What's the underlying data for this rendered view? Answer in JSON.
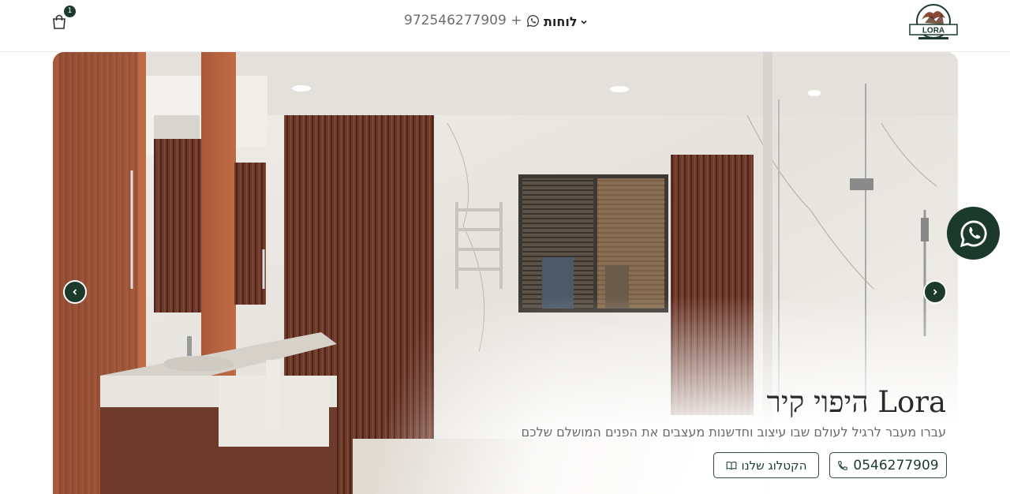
{
  "header": {
    "cart_count": "1",
    "phone": "972546277909 +",
    "menu_label": "לוחות",
    "logo_text": "LORA"
  },
  "hero": {
    "title": "Lora היפוי קיר",
    "subtitle": "עברו מעבר לרגיל לעולם שבו עיצוב וחדשנות מעצבים את הפנים המושלם שלכם",
    "phone_button": "0546277909",
    "catalog_button": "הקטלוג שלנו"
  },
  "colors": {
    "brand_dark_green": "#1b3a2c",
    "wood": "#8a4a35"
  },
  "icons": [
    "cart-icon",
    "whatsapp-icon",
    "chevron-down-icon",
    "chevron-left-icon",
    "chevron-right-icon",
    "phone-icon",
    "book-icon"
  ]
}
